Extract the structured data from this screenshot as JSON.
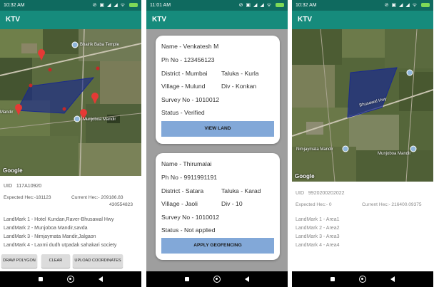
{
  "colors": {
    "statusbar": "#0f6a5f",
    "appbar": "#168b7c",
    "button": "#dcdcdc",
    "card_button": "#82a8d8",
    "polygon": "#1a2a8c"
  },
  "screen1": {
    "status": {
      "time": "10:32 AM",
      "left_icons": "◢ P",
      "right_icons": "⊘ ▣ ◢ ◢ ᯤ"
    },
    "app_title": "KTV",
    "map": {
      "labels": [
        "Bhairik Baba Temple",
        "Munjoboa Mandir",
        "Mandir"
      ],
      "logo": "Google"
    },
    "uid_label": "UID",
    "uid_value": "117A10920",
    "expected_hec": "Expected Hec:-181123",
    "current_hec": "Current Hec:- 209186.83",
    "current_hec_2": "430554823",
    "landmarks": [
      "LandMark 1 - Hotel Kundan,Raver-Bhusawal Hwy",
      "LandMark 2 - Munjoboa Mandir,savda",
      "LandMark 3 - Nimjaymata Mandir,Jalgaon",
      "LandMark 4 - Laxmi dudh utpadak sahakari society"
    ],
    "buttons": {
      "draw": "DRAW POLYGON",
      "clear": "CLEAR",
      "upload": "UPLOAD COORDINATES"
    }
  },
  "screen2": {
    "status": {
      "time": "11:01 AM",
      "left_icons": "◢ ◢ P",
      "right_icons": "⊘ ▣ ◢ ◢ ᯤ"
    },
    "app_title": "KTV",
    "card1": {
      "name": "Name - Venkatesh M",
      "phone": "Ph No - 123456123",
      "district": "District - Mumbai",
      "taluka": "Taluka - Kurla",
      "village": "Village - Mulund",
      "div": "Div - Konkan",
      "survey": "Survey No - 1010012",
      "status": "Status - Verified",
      "button": "VIEW LAND"
    },
    "card2": {
      "name": "Name - Thirumalai",
      "phone": "Ph No - 9911991191",
      "district": "District - Satara",
      "taluka": "Taluka - Karad",
      "village": "Village - Jaoli",
      "div": "Div - 10",
      "survey": "Survey No - 1010012",
      "status": "Status - Not applied",
      "button": "APPLY GEOFENCING"
    }
  },
  "screen3": {
    "status": {
      "time": "10:32 AM",
      "left_icons": "◢ P",
      "right_icons": "⊘ ▣ ◢ ◢ ᯤ"
    },
    "app_title": "KTV",
    "map": {
      "labels": [
        "Nimjaymata Mandir",
        "Munjoboa Mandir",
        "Bhusawal Hwy"
      ],
      "logo": "Google"
    },
    "uid_label": "UID",
    "uid_value": "9920200202022",
    "expected_hec": "Expected Hec:- 0",
    "current_hec": "Current Hec:- 216400.09375",
    "landmarks": [
      "LandMark 1 - Area1",
      "LandMark 2 - Area2",
      "LandMark 3 - Area3",
      "LandMark 4 - Area4"
    ]
  }
}
